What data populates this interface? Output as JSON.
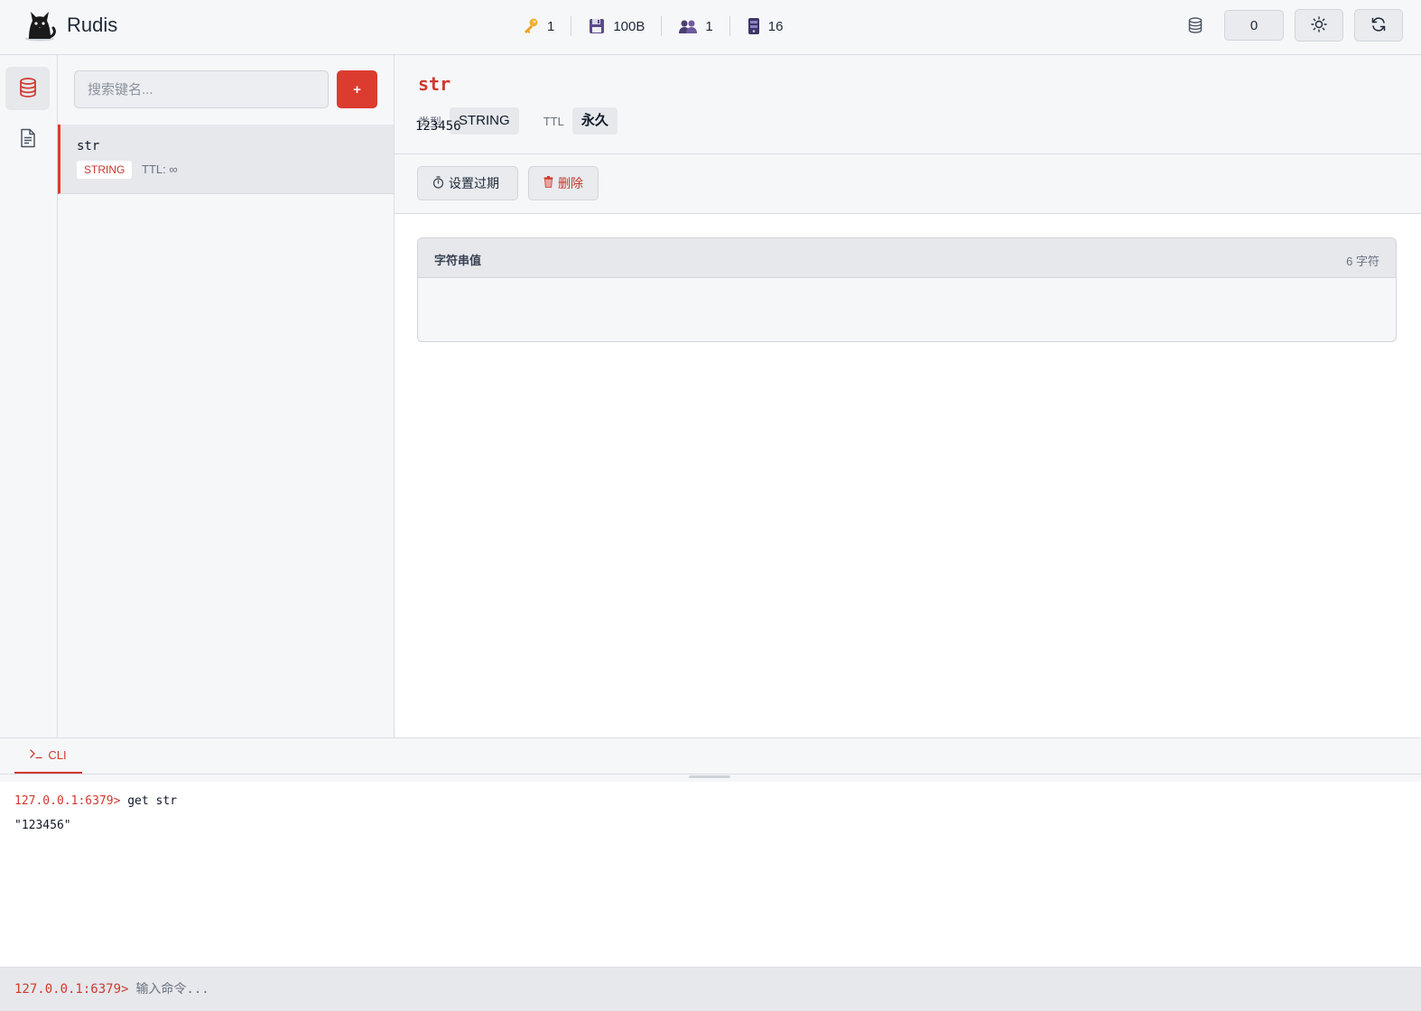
{
  "app": {
    "name": "Rudis",
    "logo_icon": "cat-logo-icon"
  },
  "stats": [
    {
      "icon": "key-icon",
      "value": "1"
    },
    {
      "icon": "floppy-disk-icon",
      "value": "100B"
    },
    {
      "icon": "users-icon",
      "value": "1"
    },
    {
      "icon": "server-icon",
      "value": "16"
    }
  ],
  "header_right": {
    "db_index": "0",
    "theme_icon": "sun-icon",
    "refresh_icon": "refresh-icon"
  },
  "sidebar": {
    "search_placeholder": "搜索键名...",
    "add_label": "+"
  },
  "keys": [
    {
      "name": "str",
      "type": "STRING",
      "ttl": "TTL: ∞"
    }
  ],
  "detail": {
    "title": "str",
    "type_label": "类型",
    "type_value": "STRING",
    "ttl_label": "TTL",
    "ttl_value": "永久",
    "set_expire_label": "设置过期",
    "delete_label": "删除",
    "value_card_title": "字符串值",
    "value_length": "6 字符",
    "value": "123456"
  },
  "cli": {
    "tab_label": "CLI",
    "history": [
      {
        "prompt": "127.0.0.1:6379>",
        "command": "get str"
      },
      {
        "output": "\"123456\""
      }
    ],
    "prompt": "127.0.0.1:6379>",
    "input_placeholder": "输入命令..."
  },
  "colors": {
    "accent": "#d1382d",
    "button_red": "#dc3b2f"
  }
}
